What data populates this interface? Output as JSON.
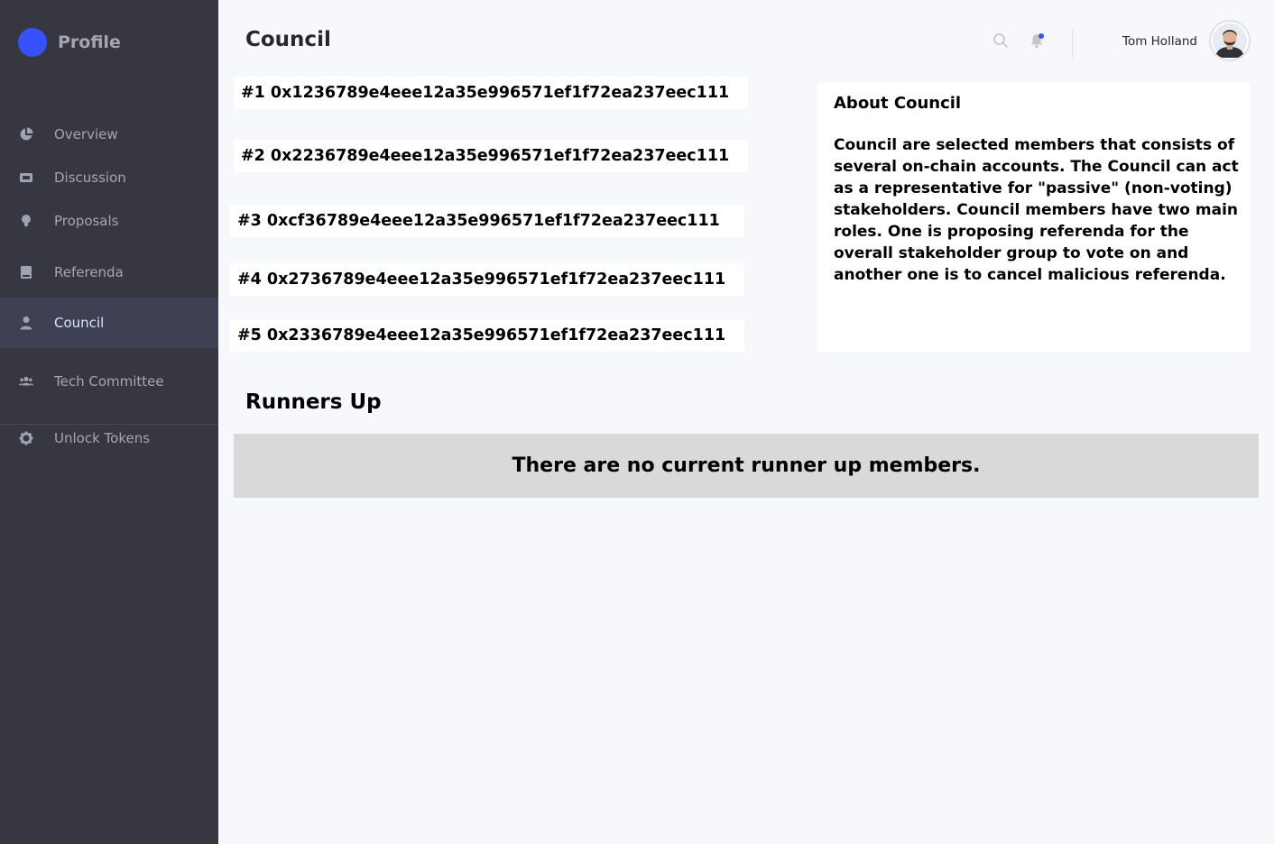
{
  "sidebar": {
    "brand": {
      "title": "Profile",
      "logo_color": "#3751ff"
    },
    "items": [
      {
        "label": "Overview",
        "icon": "pie-chart-icon"
      },
      {
        "label": "Discussion",
        "icon": "ticket-icon"
      },
      {
        "label": "Proposals",
        "icon": "lightbulb-icon"
      },
      {
        "label": "Referenda",
        "icon": "book-icon"
      },
      {
        "label": "Council",
        "icon": "person-icon",
        "active": true
      },
      {
        "label": "Tech Committee",
        "icon": "people-icon"
      },
      {
        "label": "Unlock Tokens",
        "icon": "gear-icon"
      }
    ]
  },
  "header": {
    "title": "Council",
    "user_name": "Tom Holland",
    "search_icon": "search-icon",
    "notification_icon": "bell-icon",
    "notification_dot_color": "#3751ff"
  },
  "council_members": [
    "#1 0x1236789e4eee12a35e996571ef1f72ea237eec111",
    "#2 0x2236789e4eee12a35e996571ef1f72ea237eec111",
    "#3 0xcf36789e4eee12a35e996571ef1f72ea237eec111",
    "#4 0x2736789e4eee12a35e996571ef1f72ea237eec111",
    "#5 0x2336789e4eee12a35e996571ef1f72ea237eec111"
  ],
  "about": {
    "title": "About Council",
    "body": "Council are selected members that consists of several on-chain accounts. The Council can act as a representative for \"passive\" (non-voting) stakeholders. Council members have two main roles. One is proposing referenda for the overall stakeholder group to vote on and another one is to cancel malicious referenda."
  },
  "runners_up": {
    "title": "Runners Up",
    "empty_message": "There are no current runner up members."
  },
  "colors": {
    "sidebar_bg": "#363740",
    "active_item_bg": "#3e4153",
    "page_bg": "#f7f8fc",
    "runners_box_bg": "#d9d9d9"
  }
}
